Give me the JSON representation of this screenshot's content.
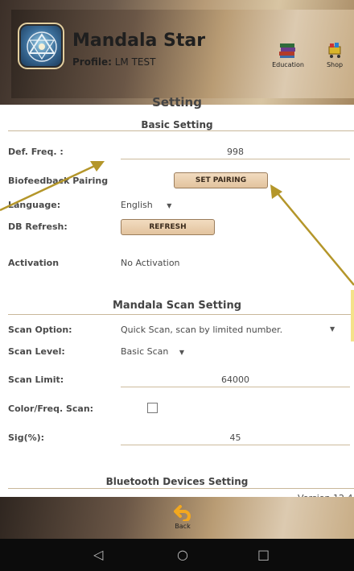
{
  "header": {
    "app_title": "Mandala Star",
    "profile_label": "Profile:",
    "profile_value": "LM TEST",
    "education_label": "Education",
    "shop_label": "Shop",
    "logo_icon": "mandala-star-logo"
  },
  "page": {
    "title": "Setting"
  },
  "basic": {
    "title": "Basic Setting",
    "def_freq_label": "Def. Freq. :",
    "def_freq_value": "998",
    "biofeedback_label": "Biofeedback Pairing",
    "set_pairing_label": "SET PAIRING",
    "language_label": "Language:",
    "language_value": "English",
    "db_refresh_label": "DB Refresh:",
    "refresh_label": "REFRESH",
    "activation_label": "Activation",
    "activation_value": "No Activation"
  },
  "scan": {
    "title": "Mandala Scan Setting",
    "scan_option_label": "Scan Option:",
    "scan_option_value": "Quick Scan, scan by limited number.",
    "scan_level_label": "Scan Level:",
    "scan_level_value": "Basic Scan",
    "scan_limit_label": "Scan Limit:",
    "scan_limit_value": "64000",
    "color_freq_label": "Color/Freq. Scan:",
    "color_freq_checked": false,
    "sig_label": "Sig(%):",
    "sig_value": "45"
  },
  "bluetooth": {
    "title": "Bluetooth Devices Setting",
    "version": "Version 12.4"
  },
  "footer": {
    "back_label": "Back",
    "back_icon": "back-arrow-icon"
  },
  "colors": {
    "accent": "#b4962a",
    "button": "#e6c7a2",
    "line": "#cdbb9d"
  }
}
